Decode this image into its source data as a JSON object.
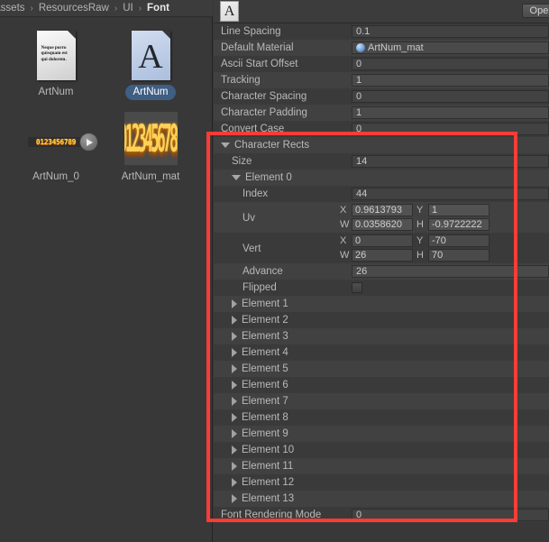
{
  "project_browser": {
    "breadcrumb": {
      "items": [
        "Assets",
        "ResourcesRaw",
        "UI",
        "Font"
      ],
      "separator": "›"
    },
    "assets": [
      {
        "name": "ArtNum",
        "kind": "text-document",
        "selected": false,
        "thumb_text": "Neque porro quisquam est qui dolorem."
      },
      {
        "name": "ArtNum",
        "kind": "font",
        "selected": true,
        "thumb_glyph": "A"
      },
      {
        "name": "ArtNum_0",
        "kind": "texture",
        "selected": false,
        "thumb_digits": "0123456789",
        "has_play_badge": true
      },
      {
        "name": "ArtNum_mat",
        "kind": "material",
        "selected": false,
        "thumb_digits": "0123456789"
      }
    ]
  },
  "inspector": {
    "header": {
      "icon": "font-asset-icon",
      "icon_glyph": "A",
      "open_button": "Open"
    },
    "properties": [
      {
        "label": "Line Spacing",
        "indent": 0,
        "type": "field",
        "value": "0.1"
      },
      {
        "label": "Default Material",
        "indent": 0,
        "type": "object",
        "value": "ArtNum_mat"
      },
      {
        "label": "Ascii Start Offset",
        "indent": 0,
        "type": "field",
        "value": "0"
      },
      {
        "label": "Tracking",
        "indent": 0,
        "type": "field",
        "value": "1"
      },
      {
        "label": "Character Spacing",
        "indent": 0,
        "type": "field",
        "value": "0"
      },
      {
        "label": "Character Padding",
        "indent": 0,
        "type": "field",
        "value": "1"
      },
      {
        "label": "Convert Case",
        "indent": 0,
        "type": "field",
        "value": "0"
      },
      {
        "label": "Character Rects",
        "indent": 0,
        "type": "foldout-open",
        "value": ""
      },
      {
        "label": "Size",
        "indent": 1,
        "type": "field",
        "value": "14"
      },
      {
        "label": "Element 0",
        "indent": 1,
        "type": "foldout-open",
        "value": ""
      },
      {
        "label": "Index",
        "indent": 2,
        "type": "field",
        "value": "44"
      },
      {
        "label": "Uv",
        "indent": 2,
        "type": "vector4",
        "vector": {
          "x": "0.9613793",
          "y": "1",
          "w": "0.0358620",
          "h": "-0.9722222"
        }
      },
      {
        "label": "Vert",
        "indent": 2,
        "type": "vector4",
        "vector": {
          "x": "0",
          "y": "-70",
          "w": "26",
          "h": "70"
        }
      },
      {
        "label": "Advance",
        "indent": 2,
        "type": "field",
        "value": "26"
      },
      {
        "label": "Flipped",
        "indent": 2,
        "type": "checkbox",
        "value": "",
        "checked": false
      },
      {
        "label": "Element 1",
        "indent": 1,
        "type": "foldout-closed",
        "value": ""
      },
      {
        "label": "Element 2",
        "indent": 1,
        "type": "foldout-closed",
        "value": ""
      },
      {
        "label": "Element 3",
        "indent": 1,
        "type": "foldout-closed",
        "value": ""
      },
      {
        "label": "Element 4",
        "indent": 1,
        "type": "foldout-closed",
        "value": ""
      },
      {
        "label": "Element 5",
        "indent": 1,
        "type": "foldout-closed",
        "value": ""
      },
      {
        "label": "Element 6",
        "indent": 1,
        "type": "foldout-closed",
        "value": ""
      },
      {
        "label": "Element 7",
        "indent": 1,
        "type": "foldout-closed",
        "value": ""
      },
      {
        "label": "Element 8",
        "indent": 1,
        "type": "foldout-closed",
        "value": ""
      },
      {
        "label": "Element 9",
        "indent": 1,
        "type": "foldout-closed",
        "value": ""
      },
      {
        "label": "Element 10",
        "indent": 1,
        "type": "foldout-closed",
        "value": ""
      },
      {
        "label": "Element 11",
        "indent": 1,
        "type": "foldout-closed",
        "value": ""
      },
      {
        "label": "Element 12",
        "indent": 1,
        "type": "foldout-closed",
        "value": ""
      },
      {
        "label": "Element 13",
        "indent": 1,
        "type": "foldout-closed",
        "value": ""
      },
      {
        "label": "Font Rendering Mode",
        "indent": 0,
        "type": "field",
        "value": "0"
      }
    ],
    "vector_axes": {
      "x": "X",
      "y": "Y",
      "w": "W",
      "h": "H"
    }
  },
  "annotation": {
    "shape": "rectangle",
    "color": "#ff3b36"
  }
}
